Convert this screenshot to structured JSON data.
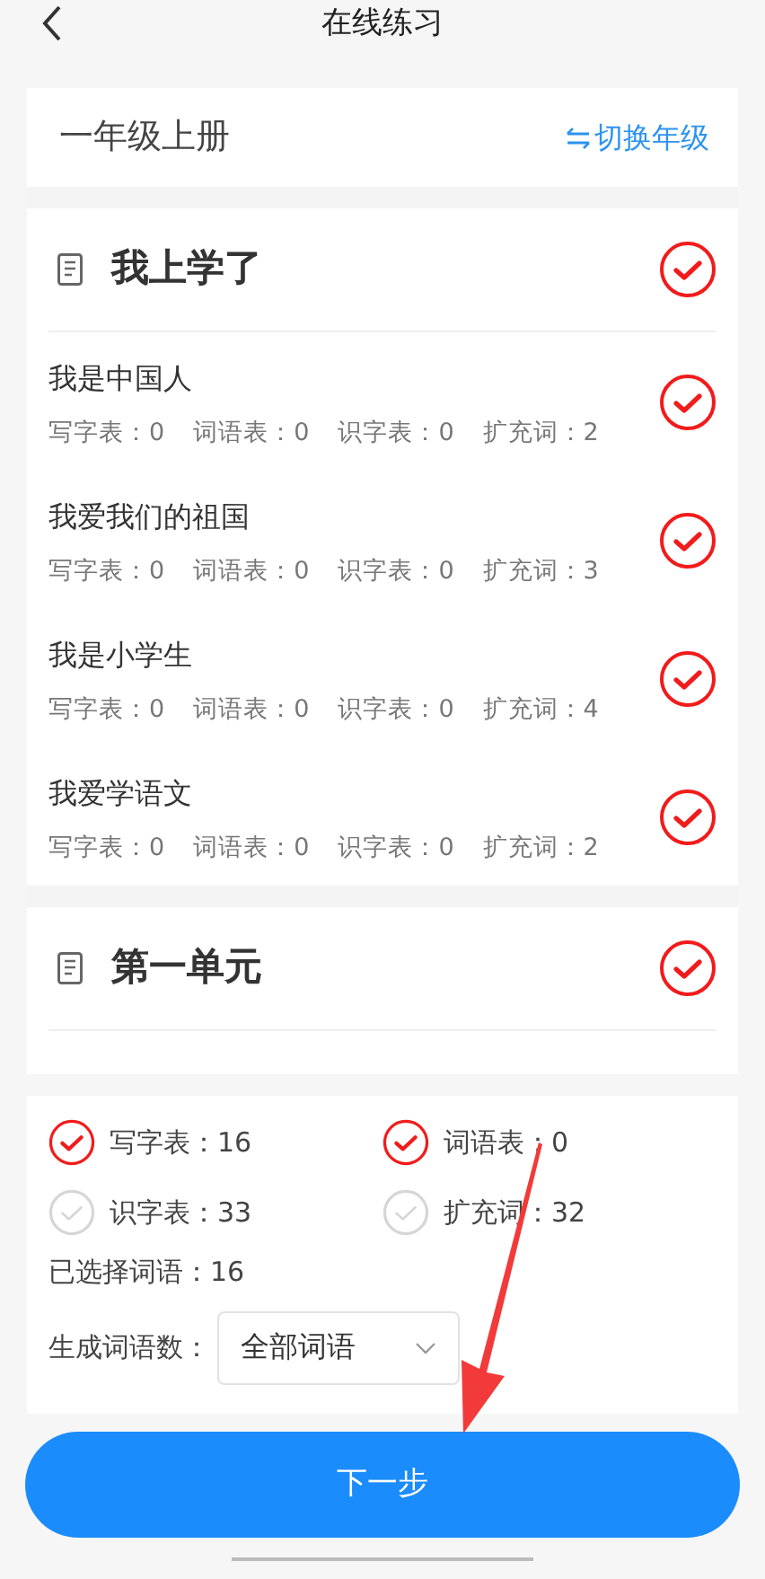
{
  "header": {
    "title": "在线练习"
  },
  "grade": {
    "name": "一年级上册",
    "switch_label": "切换年级"
  },
  "units": [
    {
      "title": "我上学了",
      "checked": true,
      "lessons": [
        {
          "title": "我是中国人",
          "checked": true,
          "stats": [
            "写字表：0",
            "词语表：0",
            "识字表：0",
            "扩充词：2"
          ]
        },
        {
          "title": "我爱我们的祖国",
          "checked": true,
          "stats": [
            "写字表：0",
            "词语表：0",
            "识字表：0",
            "扩充词：3"
          ]
        },
        {
          "title": "我是小学生",
          "checked": true,
          "stats": [
            "写字表：0",
            "词语表：0",
            "识字表：0",
            "扩充词：4"
          ]
        },
        {
          "title": "我爱学语文",
          "checked": true,
          "stats": [
            "写字表：0",
            "词语表：0",
            "识字表：0",
            "扩充词：2"
          ]
        }
      ]
    },
    {
      "title": "第一单元",
      "checked": true
    }
  ],
  "summary": {
    "tables": [
      {
        "label": "写字表：16",
        "checked": true
      },
      {
        "label": "词语表：0",
        "checked": true
      },
      {
        "label": "识字表：33",
        "checked": false
      },
      {
        "label": "扩充词：32",
        "checked": false
      }
    ],
    "selected_count": "已选择词语：16",
    "count_label": "生成词语数：",
    "count_select": {
      "value": "全部词语"
    }
  },
  "next_button": "下一步"
}
